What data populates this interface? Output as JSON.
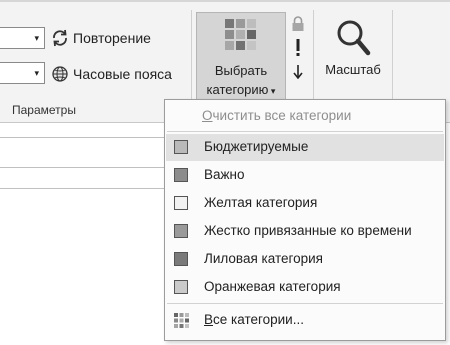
{
  "ribbon": {
    "repeat_label": "Повторение",
    "timezones_label": "Часовые пояса",
    "group_label": "Параметры",
    "categorize_line1": "Выбрать",
    "categorize_line2": "категорию",
    "zoom_label": "Масштаб",
    "combo_caret": "▾"
  },
  "menu": {
    "clear_label": "Очистить все категории",
    "items": [
      {
        "label": "Бюджетируемые",
        "color": "#b9b9b9"
      },
      {
        "label": "Важно",
        "color": "#8c8c8c"
      },
      {
        "label": "Желтая категория",
        "color": "#f2f2f2"
      },
      {
        "label": "Жестко привязанные ко времени",
        "color": "#9a9a9a"
      },
      {
        "label": "Лиловая категория",
        "color": "#7a7a7a"
      },
      {
        "label": "Оранжевая категория",
        "color": "#cacaca"
      }
    ],
    "all_label": "Все категории..."
  }
}
